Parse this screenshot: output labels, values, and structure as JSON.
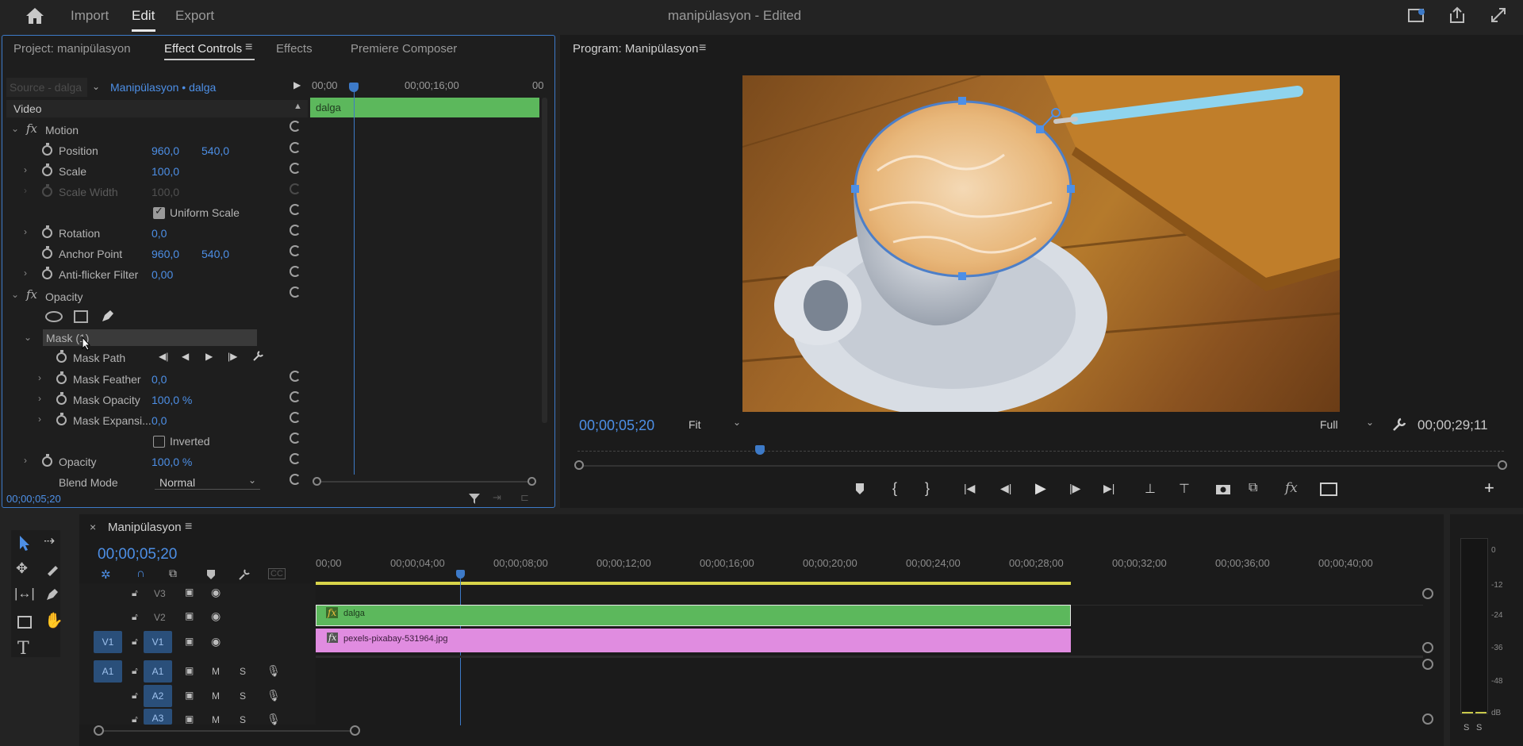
{
  "topbar": {
    "home_icon": "home-icon",
    "menu": [
      "Import",
      "Edit",
      "Export"
    ],
    "active_menu": "Edit",
    "title": "manipülasyon",
    "title_suffix": " - Edited"
  },
  "effect_controls": {
    "tabs": [
      "Project: manipülasyon",
      "Effect Controls",
      "Effects",
      "Premiere Composer"
    ],
    "source_label": "Source - dalga",
    "clip_label": "Manipülasyon • dalga",
    "ruler": [
      "00;00",
      "00;00;16;00",
      "00"
    ],
    "clip_bar": "dalga",
    "section": "Video",
    "motion": "Motion",
    "position": {
      "label": "Position",
      "x": "960,0",
      "y": "540,0"
    },
    "scale": {
      "label": "Scale",
      "value": "100,0"
    },
    "scale_width": {
      "label": "Scale Width",
      "value": "100,0"
    },
    "uniform_scale": "Uniform Scale",
    "rotation": {
      "label": "Rotation",
      "value": "0,0"
    },
    "anchor": {
      "label": "Anchor Point",
      "x": "960,0",
      "y": "540,0"
    },
    "antiflicker": {
      "label": "Anti-flicker Filter",
      "value": "0,00"
    },
    "opacity_group": "Opacity",
    "mask": "Mask (1)",
    "mask_path": "Mask Path",
    "mask_feather": {
      "label": "Mask Feather",
      "value": "0,0"
    },
    "mask_opacity": {
      "label": "Mask Opacity",
      "value": "100,0 %"
    },
    "mask_expansion": {
      "label": "Mask Expansi...",
      "value": "0,0"
    },
    "inverted": "Inverted",
    "opacity": {
      "label": "Opacity",
      "value": "100,0 %"
    },
    "blend_mode": {
      "label": "Blend Mode",
      "value": "Normal"
    },
    "timecode": "00;00;05;20"
  },
  "program": {
    "title": "Program: Manipülasyon",
    "timecode": "00;00;05;20",
    "fit": "Fit",
    "quality": "Full",
    "duration": "00;00;29;11",
    "playhead_fraction": 0.196
  },
  "timeline": {
    "title": "Manipülasyon",
    "timecode": "00;00;05;20",
    "ruler": [
      "00;00",
      "00;00;04;00",
      "00;00;08;00",
      "00;00;12;00",
      "00;00;16;00",
      "00;00;20;00",
      "00;00;24;00",
      "00;00;28;00",
      "00;00;32;00",
      "00;00;36;00",
      "00;00;40;00"
    ],
    "video_tracks": [
      "V3",
      "V2",
      "V1"
    ],
    "audio_tracks": [
      "A1",
      "A2",
      "A3"
    ],
    "source_v": "V1",
    "source_a": "A1",
    "clip_v2": "dalga",
    "clip_v1": "pexels-pixabay-531964.jpg",
    "m": "M",
    "s": "S"
  },
  "meter": {
    "labels": [
      "0",
      "-12",
      "-24",
      "-36",
      "-48",
      "dB"
    ],
    "s1": "S",
    "s2": "S"
  },
  "colors": {
    "accent": "#3d7ac8",
    "timecode_blue": "#4d8fe6",
    "clip_green": "#5cb85c",
    "clip_pink": "#e08ce0"
  }
}
